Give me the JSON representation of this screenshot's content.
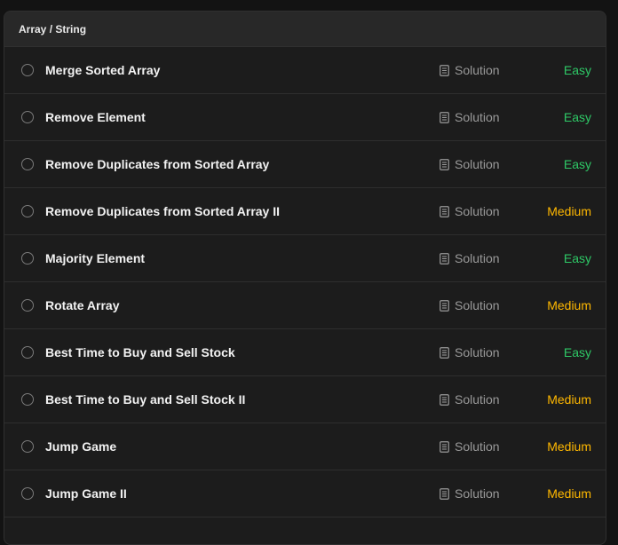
{
  "section": {
    "title": "Array / String"
  },
  "solution_label": "Solution",
  "colors": {
    "easy": "#2ec866",
    "medium": "#ffb800"
  },
  "problems": [
    {
      "title": "Merge Sorted Array",
      "difficulty": "Easy"
    },
    {
      "title": "Remove Element",
      "difficulty": "Easy"
    },
    {
      "title": "Remove Duplicates from Sorted Array",
      "difficulty": "Easy"
    },
    {
      "title": "Remove Duplicates from Sorted Array II",
      "difficulty": "Medium"
    },
    {
      "title": "Majority Element",
      "difficulty": "Easy"
    },
    {
      "title": "Rotate Array",
      "difficulty": "Medium"
    },
    {
      "title": "Best Time to Buy and Sell Stock",
      "difficulty": "Easy"
    },
    {
      "title": "Best Time to Buy and Sell Stock II",
      "difficulty": "Medium"
    },
    {
      "title": "Jump Game",
      "difficulty": "Medium"
    },
    {
      "title": "Jump Game II",
      "difficulty": "Medium"
    }
  ]
}
